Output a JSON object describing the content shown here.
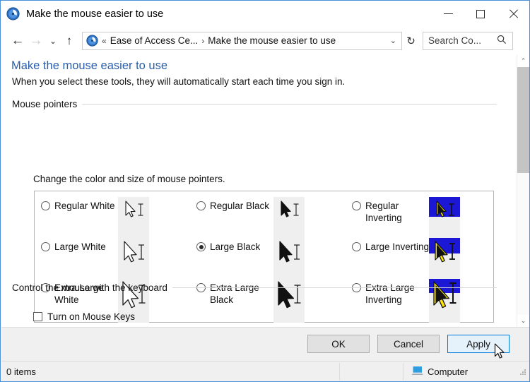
{
  "window": {
    "title": "Make the mouse easier to use",
    "icon": "ease-of-access-icon",
    "minimize_label": "Minimize",
    "maximize_label": "Maximize",
    "close_label": "Close"
  },
  "nav": {
    "back_icon": "←",
    "forward_icon": "→",
    "recent_icon": "⌄",
    "up_icon": "↑",
    "refresh_icon": "↻"
  },
  "address": {
    "icon": "ease-of-access-icon",
    "overflow_chevron": "«",
    "crumb1": "Ease of Access Ce...",
    "separator": "›",
    "crumb2": "Make the mouse easier to use",
    "dropdown_icon": "⌄"
  },
  "search": {
    "value": "",
    "placeholder": "Search Co...",
    "icon": "search-icon"
  },
  "page": {
    "title": "Make the mouse easier to use",
    "subtitle": "When you select these tools, they will automatically start each time you sign in.",
    "section_pointers": "Mouse pointers",
    "pointers_description": "Change the color and size of mouse pointers.",
    "section_keyboard": "Control the mouse with the keyboard",
    "mouse_keys_label": "Turn on Mouse Keys",
    "mouse_keys_checked": false
  },
  "pointers": {
    "selected": "Large Black",
    "options": [
      {
        "label": "Regular White",
        "style": "white",
        "size": "regular",
        "checked": false
      },
      {
        "label": "Regular Black",
        "style": "black",
        "size": "regular",
        "checked": false
      },
      {
        "label": "Regular Inverting",
        "style": "inverting",
        "size": "regular",
        "checked": false
      },
      {
        "label": "Large White",
        "style": "white",
        "size": "large",
        "checked": false
      },
      {
        "label": "Large Black",
        "style": "black",
        "size": "large",
        "checked": true
      },
      {
        "label": "Large Inverting",
        "style": "inverting",
        "size": "large",
        "checked": false
      },
      {
        "label": "Extra Large White",
        "style": "white",
        "size": "xlarge",
        "checked": false
      },
      {
        "label": "Extra Large Black",
        "style": "black",
        "size": "xlarge",
        "checked": false
      },
      {
        "label": "Extra Large Inverting",
        "style": "inverting",
        "size": "xlarge",
        "checked": false
      }
    ]
  },
  "footer": {
    "ok_label": "OK",
    "cancel_label": "Cancel",
    "apply_label": "Apply",
    "hovered_button": "Apply"
  },
  "statusbar": {
    "items_text": "0 items",
    "computer_label": "Computer",
    "computer_icon": "computer-icon"
  },
  "scrollbar": {
    "up_icon": "⌃",
    "down_icon": "⌄",
    "thumb_position": "top"
  },
  "colors": {
    "window_border": "#4a90d9",
    "title_link": "#2b5faa",
    "accent": "#0078d7",
    "hover_fill": "#e5f1fb",
    "footer_bg": "#f0f0f0",
    "preview_bg": "#efefef",
    "inverting_blue": "#1b17d5",
    "inverting_yellow": "#ffe500"
  }
}
